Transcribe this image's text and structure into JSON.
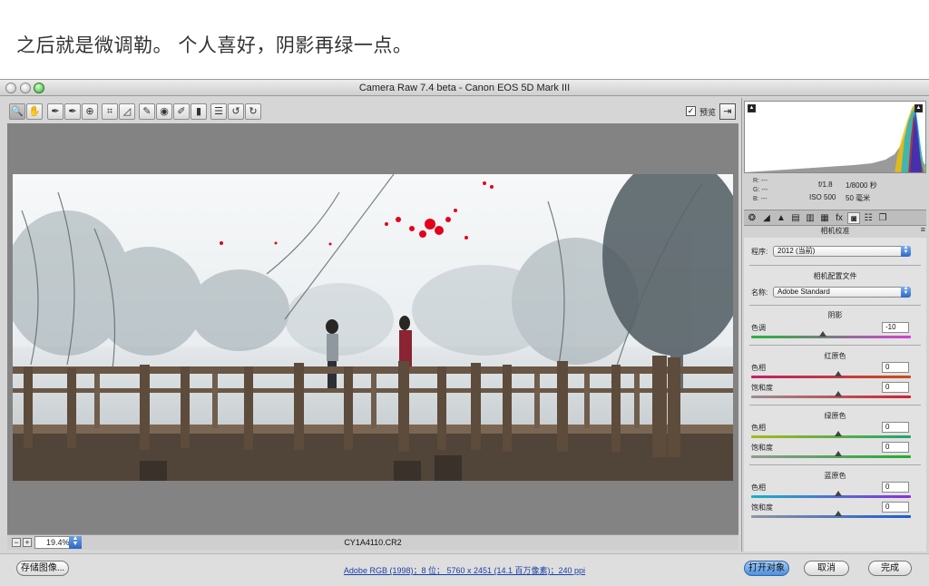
{
  "caption": "之后就是微调勒。 个人喜好，阴影再绿一点。",
  "window": {
    "title": "Camera Raw 7.4 beta -  Canon EOS 5D Mark III"
  },
  "toolbar": {
    "tools": [
      {
        "icon": "zoom-icon",
        "glyph": "🔍"
      },
      {
        "icon": "hand-icon",
        "glyph": "✋"
      },
      {
        "icon": "white-balance-icon",
        "glyph": "✒"
      },
      {
        "icon": "color-sampler-icon",
        "glyph": "✒"
      },
      {
        "icon": "target-adjust-icon",
        "glyph": "⊕"
      },
      {
        "icon": "crop-icon",
        "glyph": "⌗"
      },
      {
        "icon": "straighten-icon",
        "glyph": "◿"
      },
      {
        "icon": "spot-removal-icon",
        "glyph": "✎"
      },
      {
        "icon": "red-eye-icon",
        "glyph": "◉"
      },
      {
        "icon": "adjustment-brush-icon",
        "glyph": "✐"
      },
      {
        "icon": "graduated-filter-icon",
        "glyph": "▮"
      },
      {
        "icon": "preferences-icon",
        "glyph": "☰"
      },
      {
        "icon": "rotate-left-icon",
        "glyph": "↺"
      },
      {
        "icon": "rotate-right-icon",
        "glyph": "↻"
      }
    ],
    "preview_checked": "✓",
    "preview_label": "预览",
    "fullscreen_glyph": "⇥"
  },
  "status": {
    "zoom_out": "−",
    "zoom_in": "+",
    "zoom_value": "19.4%",
    "filename": "CY1A4110.CR2"
  },
  "bottom": {
    "save_label": "存储图像...",
    "workflow_link": "Adobe RGB (1998)；8 位； 5760 x 2451 (14.1 百万像素)；240 ppi",
    "open_label": "打开对象",
    "cancel_label": "取消",
    "done_label": "完成"
  },
  "histogram": {
    "clip_shadow": "▲",
    "clip_highlight": "▲"
  },
  "info": {
    "r": "R:  ---",
    "g": "G:  ---",
    "b": "B:  ---",
    "aperture": "f/1.8",
    "shutter": "1/8000 秒",
    "iso": "ISO 500",
    "focal": "50 毫米"
  },
  "panel_tabs": [
    {
      "icon": "basic-icon",
      "glyph": "❂"
    },
    {
      "icon": "tone-curve-icon",
      "glyph": "◢"
    },
    {
      "icon": "detail-icon",
      "glyph": "▲"
    },
    {
      "icon": "hsl-icon",
      "glyph": "▤"
    },
    {
      "icon": "split-toning-icon",
      "glyph": "▥"
    },
    {
      "icon": "lens-corrections-icon",
      "glyph": "▦"
    },
    {
      "icon": "effects-icon",
      "glyph": "fx"
    },
    {
      "icon": "camera-calibration-icon",
      "glyph": "◙"
    },
    {
      "icon": "presets-icon",
      "glyph": "☷"
    },
    {
      "icon": "snapshots-icon",
      "glyph": "❐"
    }
  ],
  "calibration": {
    "title": "相机校准",
    "process_label": "程序:",
    "process_value": "2012 (当前)",
    "profile_title": "相机配置文件",
    "name_label": "名称:",
    "name_value": "Adobe Standard",
    "shadows_title": "阴影",
    "tint_label": "色调",
    "tint_value": "-10",
    "tint_fraction": 0.45,
    "red_title": "红原色",
    "red_hue_label": "色相",
    "red_hue_value": "0",
    "red_sat_label": "饱和度",
    "red_sat_value": "0",
    "green_title": "绿原色",
    "green_hue_label": "色相",
    "green_hue_value": "0",
    "green_sat_label": "饱和度",
    "green_sat_value": "0",
    "blue_title": "蓝原色",
    "blue_hue_label": "色相",
    "blue_hue_value": "0",
    "blue_sat_label": "饱和度",
    "blue_sat_value": "0"
  }
}
